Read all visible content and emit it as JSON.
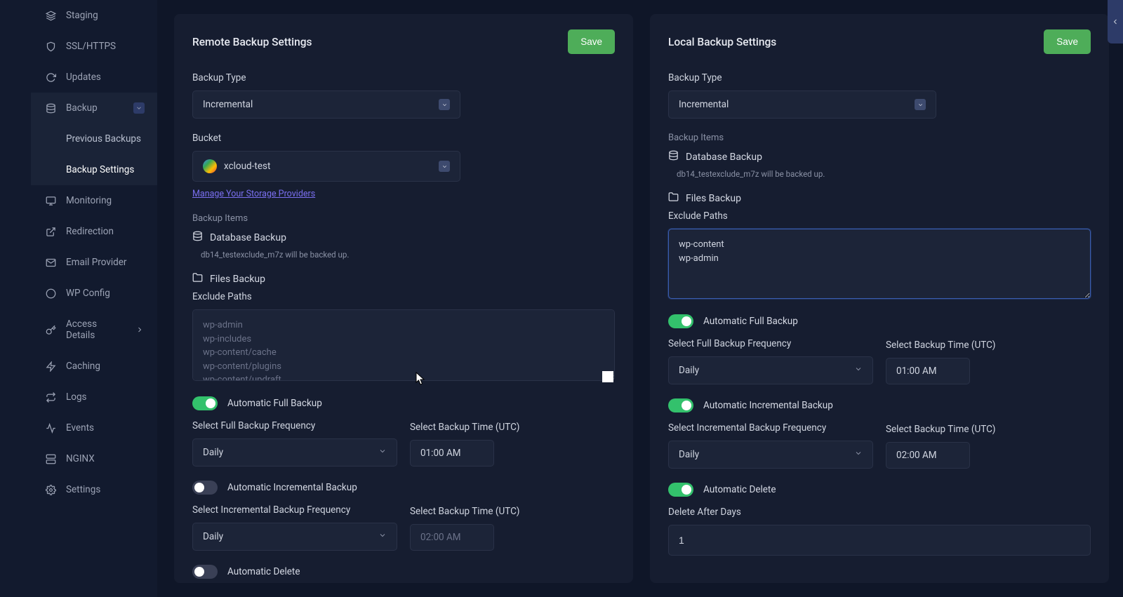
{
  "sidebar": {
    "items": [
      {
        "icon": "layers-icon",
        "label": "Staging"
      },
      {
        "icon": "shield-icon",
        "label": "SSL/HTTPS"
      },
      {
        "icon": "refresh-icon",
        "label": "Updates"
      },
      {
        "icon": "database-icon",
        "label": "Backup"
      },
      {
        "icon": "monitor-icon",
        "label": "Monitoring"
      },
      {
        "icon": "redirect-icon",
        "label": "Redirection"
      },
      {
        "icon": "mail-icon",
        "label": "Email Provider"
      },
      {
        "icon": "wp-icon",
        "label": "WP Config"
      },
      {
        "icon": "key-icon",
        "label": "Access Details"
      },
      {
        "icon": "zap-icon",
        "label": "Caching"
      },
      {
        "icon": "logs-icon",
        "label": "Logs"
      },
      {
        "icon": "activity-icon",
        "label": "Events"
      },
      {
        "icon": "server-icon",
        "label": "NGINX"
      },
      {
        "icon": "gear-icon",
        "label": "Settings"
      }
    ],
    "sub_items": [
      {
        "label": "Previous Backups"
      },
      {
        "label": "Backup Settings"
      }
    ]
  },
  "remote": {
    "title": "Remote Backup Settings",
    "save": "Save",
    "backup_type_label": "Backup Type",
    "backup_type_value": "Incremental",
    "bucket_label": "Bucket",
    "bucket_value": "xcloud-test",
    "manage_link": "Manage Your Storage Providers",
    "backup_items_label": "Backup Items",
    "db_backup_label": "Database Backup",
    "db_backup_desc": "db14_testexclude_m7z will be backed up.",
    "files_backup_label": "Files Backup",
    "exclude_paths_label": "Exclude Paths",
    "exclude_placeholder": "wp-admin\nwp-includes\nwp-content/cache\nwp-content/plugins\nwp-content/updraft",
    "auto_full_label": "Automatic Full Backup",
    "full_freq_label": "Select Full Backup Frequency",
    "full_freq_value": "Daily",
    "full_time_label": "Select Backup Time (UTC)",
    "full_time_value": "01:00 AM",
    "auto_incr_label": "Automatic Incremental Backup",
    "incr_freq_label": "Select Incremental Backup Frequency",
    "incr_freq_value": "Daily",
    "incr_time_label": "Select Backup Time (UTC)",
    "incr_time_placeholder": "02:00 AM",
    "auto_delete_label": "Automatic Delete"
  },
  "local": {
    "title": "Local Backup Settings",
    "save": "Save",
    "backup_type_label": "Backup Type",
    "backup_type_value": "Incremental",
    "backup_items_label": "Backup Items",
    "db_backup_label": "Database Backup",
    "db_backup_desc": "db14_testexclude_m7z will be backed up.",
    "files_backup_label": "Files Backup",
    "exclude_paths_label": "Exclude Paths",
    "exclude_value": "wp-content\nwp-admin",
    "auto_full_label": "Automatic Full Backup",
    "full_freq_label": "Select Full Backup Frequency",
    "full_freq_value": "Daily",
    "full_time_label": "Select Backup Time (UTC)",
    "full_time_value": "01:00 AM",
    "auto_incr_label": "Automatic Incremental Backup",
    "incr_freq_label": "Select Incremental Backup Frequency",
    "incr_freq_value": "Daily",
    "incr_time_label": "Select Backup Time (UTC)",
    "incr_time_value": "02:00 AM",
    "auto_delete_label": "Automatic Delete",
    "delete_days_label": "Delete After Days",
    "delete_days_value": "1"
  }
}
